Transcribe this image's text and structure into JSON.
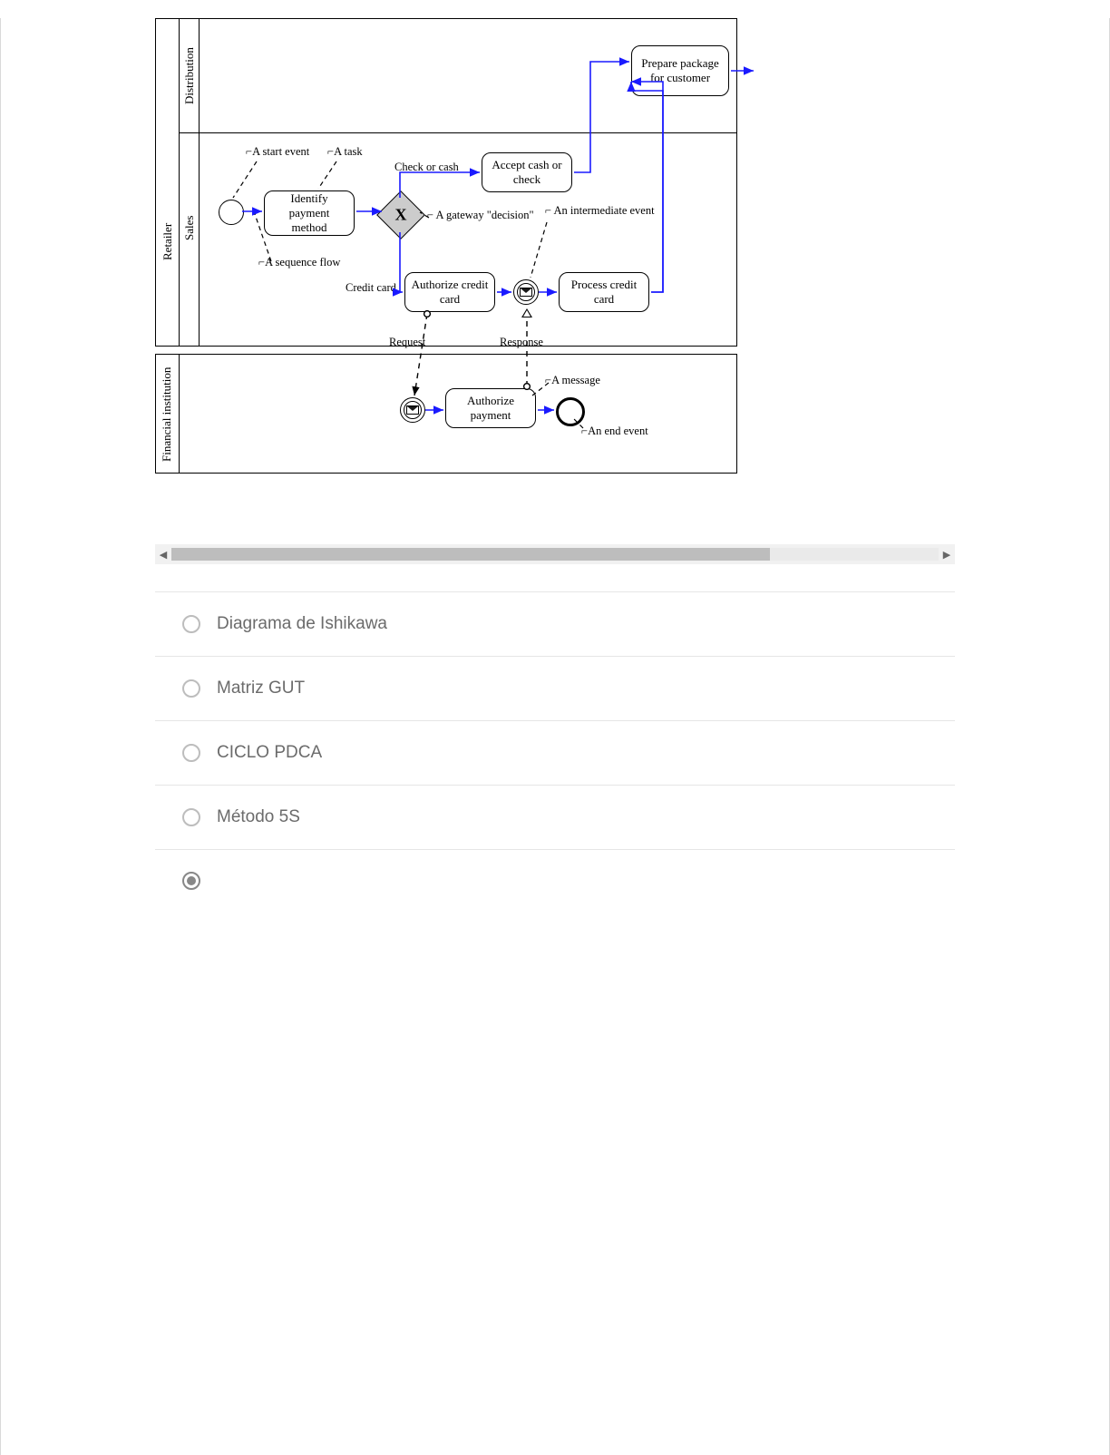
{
  "diagram": {
    "lanes": {
      "distribution": "Distribution",
      "retailer": "Retailer",
      "sales": "Sales",
      "financial": "Financial institution"
    },
    "tasks": {
      "prepare": "Prepare package for customer",
      "identify": "Identify payment method",
      "accept": "Accept cash or check",
      "authorize_cc": "Authorize credit card",
      "process_cc": "Process credit card",
      "authorize_pay": "Authorize payment"
    },
    "labels": {
      "start_event": "A start event",
      "a_task": "A task",
      "check_or_cash": "Check or cash",
      "gateway_note": "A gateway \"decision\"",
      "seq_flow": "A sequence flow",
      "credit_card": "Credit card",
      "intermediate": "An intermediate event",
      "request": "Request",
      "response": "Response",
      "a_message": "A message",
      "end_event": "An end event"
    }
  },
  "options": [
    {
      "label": "Diagrama de Ishikawa",
      "selected": false
    },
    {
      "label": "Matriz GUT",
      "selected": false
    },
    {
      "label": "CICLO PDCA",
      "selected": false
    },
    {
      "label": "Método 5S",
      "selected": false
    },
    {
      "label": "",
      "selected": true
    }
  ]
}
